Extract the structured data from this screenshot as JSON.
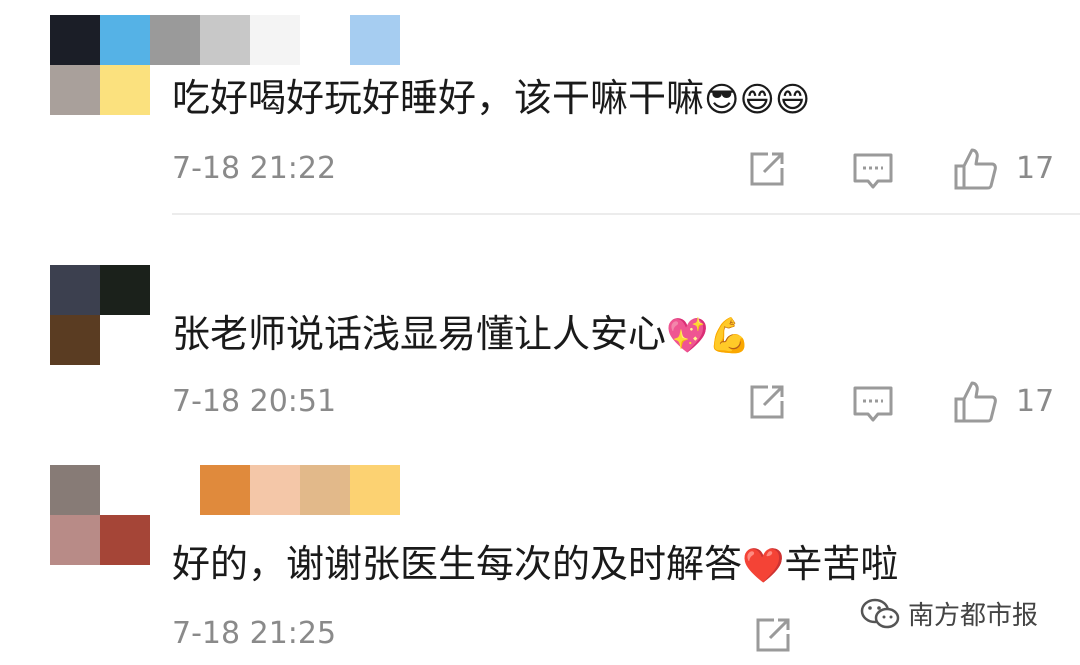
{
  "comments": [
    {
      "text": "吃好喝好玩好睡好，该干嘛干嘛",
      "emojis": "😎😄😄",
      "time": "7-18 21:22",
      "likes": "17",
      "avatar_colors": [
        "#1b1e27",
        "#55b2e6",
        "#a9a09b",
        "#fbe17e"
      ],
      "name_colors": [
        "#9a9a9a",
        "#c8c8c8",
        "#f4f4f4",
        "#ffffff",
        "#a6cdf1"
      ]
    },
    {
      "text": "张老师说话浅显易懂让人安心",
      "emojis": "💖💪",
      "time": "7-18 20:51",
      "likes": "17",
      "avatar_colors": [
        "#3c404f",
        "#1b211b",
        "#5a3c22",
        "#ffffff"
      ],
      "name_colors": []
    },
    {
      "text": "好的，谢谢张医生每次的及时解答",
      "emoji_mid": "❤️",
      "text_after": "辛苦啦",
      "time": "7-18 21:25",
      "avatar_colors": [
        "#877b76",
        "#ffffff",
        "#b88b87",
        "#a54537"
      ],
      "name_colors": [
        "#e08a3c",
        "#f4c7a8",
        "#e2b98a",
        "#fcd272"
      ]
    }
  ],
  "icons": {
    "repost": "share-square-icon",
    "comment": "comment-bubble-icon",
    "like": "thumbs-up-icon"
  },
  "watermark": {
    "text": "南方都市报",
    "icon": "wechat-logo-icon"
  }
}
